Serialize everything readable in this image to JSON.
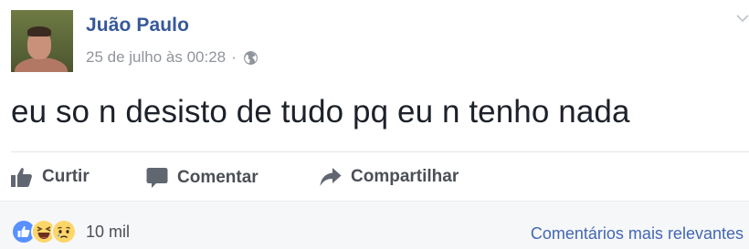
{
  "post": {
    "author_name": "Juão Paulo",
    "timestamp": "25 de julho às 00:28",
    "separator": "·",
    "privacy_icon": "globe-icon",
    "message": "eu so n desisto de tudo pq eu n tenho nada"
  },
  "actions": {
    "like_label": "Curtir",
    "comment_label": "Comentar",
    "share_label": "Compartilhar"
  },
  "reactions": {
    "types": [
      "like",
      "haha",
      "sad"
    ],
    "count": "10 mil"
  },
  "comments": {
    "sort_label": "Comentários mais relevantes"
  },
  "colors": {
    "author_link": "#365899",
    "action_text": "#4b4f56",
    "meta_text": "#90949c",
    "like_blue": "#5890ff",
    "emoji_yellow": "#fcd669",
    "link_blue": "#4267b2"
  }
}
